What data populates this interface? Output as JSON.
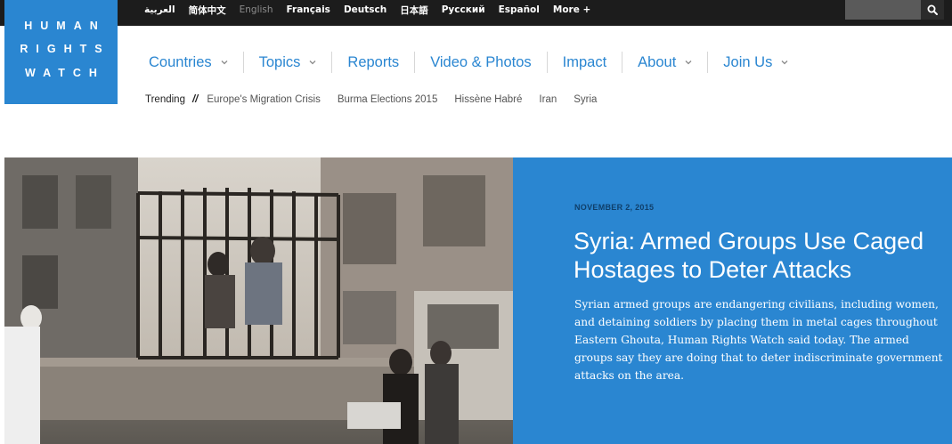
{
  "languages": [
    {
      "label": "العربية",
      "active": false
    },
    {
      "label": "简体中文",
      "active": false
    },
    {
      "label": "English",
      "active": true
    },
    {
      "label": "Français",
      "active": false
    },
    {
      "label": "Deutsch",
      "active": false
    },
    {
      "label": "日本語",
      "active": false
    },
    {
      "label": "Русский",
      "active": false
    },
    {
      "label": "Español",
      "active": false
    },
    {
      "label": "More +",
      "active": false
    }
  ],
  "search": {
    "placeholder": "",
    "icon": "search-icon"
  },
  "logo": {
    "lines": [
      "HUMAN",
      "RIGHTS",
      "WATCH"
    ],
    "color": "#2a86d1"
  },
  "nav": [
    {
      "label": "Countries",
      "has_dropdown": true
    },
    {
      "label": "Topics",
      "has_dropdown": true
    },
    {
      "label": "Reports",
      "has_dropdown": false
    },
    {
      "label": "Video & Photos",
      "has_dropdown": false
    },
    {
      "label": "Impact",
      "has_dropdown": false
    },
    {
      "label": "About",
      "has_dropdown": true
    },
    {
      "label": "Join Us",
      "has_dropdown": true
    }
  ],
  "trending": {
    "label": "Trending",
    "separator": "//",
    "items": [
      "Europe's Migration Crisis",
      "Burma Elections 2015",
      "Hissène Habré",
      "Iran",
      "Syria"
    ]
  },
  "hero": {
    "date": "NOVEMBER 2, 2015",
    "title": "Syria: Armed Groups Use Caged Hostages to Deter Attacks",
    "summary": "Syrian armed groups are endangering civilians, including women, and detaining soldiers by placing them in metal cages throughout Eastern Ghouta, Human Rights Watch said today. The armed groups say they are doing that to deter indiscriminate government attacks on the area.",
    "panel_color": "#2a86d1"
  }
}
